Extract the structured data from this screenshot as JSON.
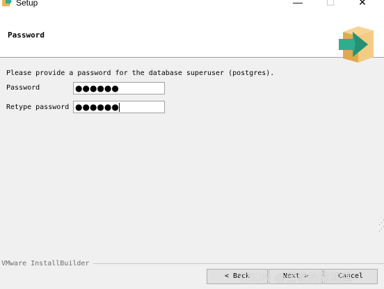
{
  "window": {
    "title": "Setup",
    "minimize_glyph": "—",
    "maximize_glyph": "☐",
    "close_glyph": "✕"
  },
  "header": {
    "page_title": "Password",
    "icon": "installer-box-arrow-icon"
  },
  "form": {
    "description": "Please provide a password for the database superuser (postgres).",
    "password_label": "Password",
    "password_value": "●●●●●●",
    "retype_label": "Retype password",
    "retype_value": "●●●●●●"
  },
  "footer": {
    "brand": "VMware InstallBuilder",
    "back_label": "< Back",
    "next_label": "Next >",
    "cancel_label": "Cancel"
  },
  "watermark": {
    "text": "CSDN @傍晚的猫和鱼"
  },
  "colors": {
    "box": "#e8b45a",
    "arrow": "#2eae8e"
  }
}
